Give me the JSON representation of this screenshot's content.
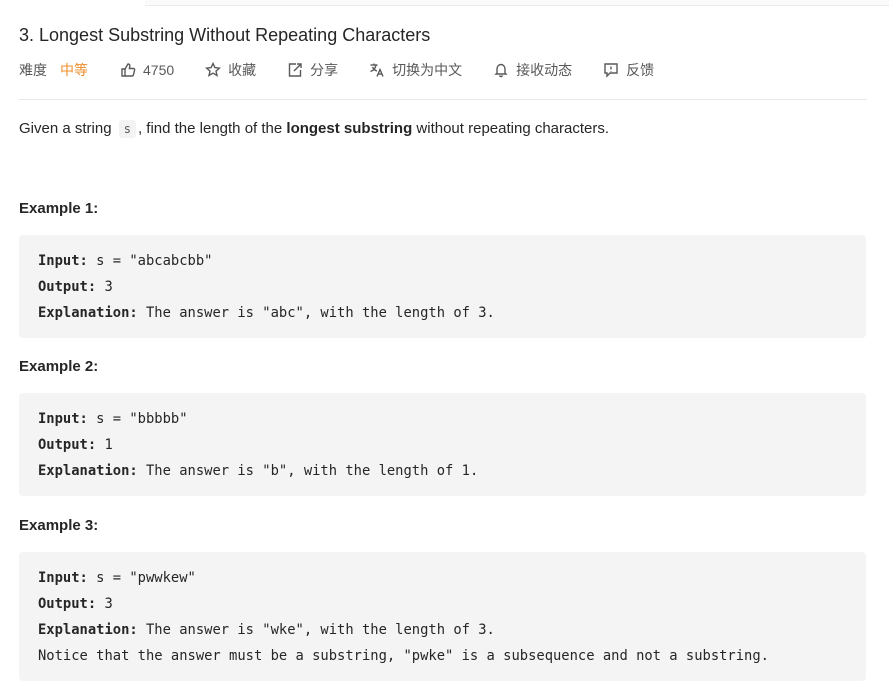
{
  "problem": {
    "title": "3. Longest Substring Without Repeating Characters"
  },
  "meta": {
    "difficulty_label": "难度",
    "difficulty_value": "中等",
    "likes": "4750",
    "favorite": "收藏",
    "share": "分享",
    "translate": "切换为中文",
    "subscribe": "接收动态",
    "feedback": "反馈",
    "colors": {
      "difficulty_medium": "#ef8d29"
    }
  },
  "description": {
    "part1": "Given a string ",
    "var": "s",
    "part2": ", find the length of the ",
    "bold": "longest substring",
    "part3": " without repeating characters."
  },
  "examples": [
    {
      "title": "Example 1:",
      "input_label": "Input:",
      "input": " s = \"abcabcbb\"",
      "output_label": "Output:",
      "output": " 3",
      "explanation_label": "Explanation:",
      "explanation": " The answer is \"abc\", with the length of 3."
    },
    {
      "title": "Example 2:",
      "input_label": "Input:",
      "input": " s = \"bbbbb\"",
      "output_label": "Output:",
      "output": " 1",
      "explanation_label": "Explanation:",
      "explanation": " The answer is \"b\", with the length of 1."
    },
    {
      "title": "Example 3:",
      "input_label": "Input:",
      "input": " s = \"pwwkew\"",
      "output_label": "Output:",
      "output": " 3",
      "explanation_label": "Explanation:",
      "explanation": " The answer is \"wke\", with the length of 3.",
      "note": "Notice that the answer must be a substring, \"pwke\" is a subsequence and not a substring."
    }
  ]
}
